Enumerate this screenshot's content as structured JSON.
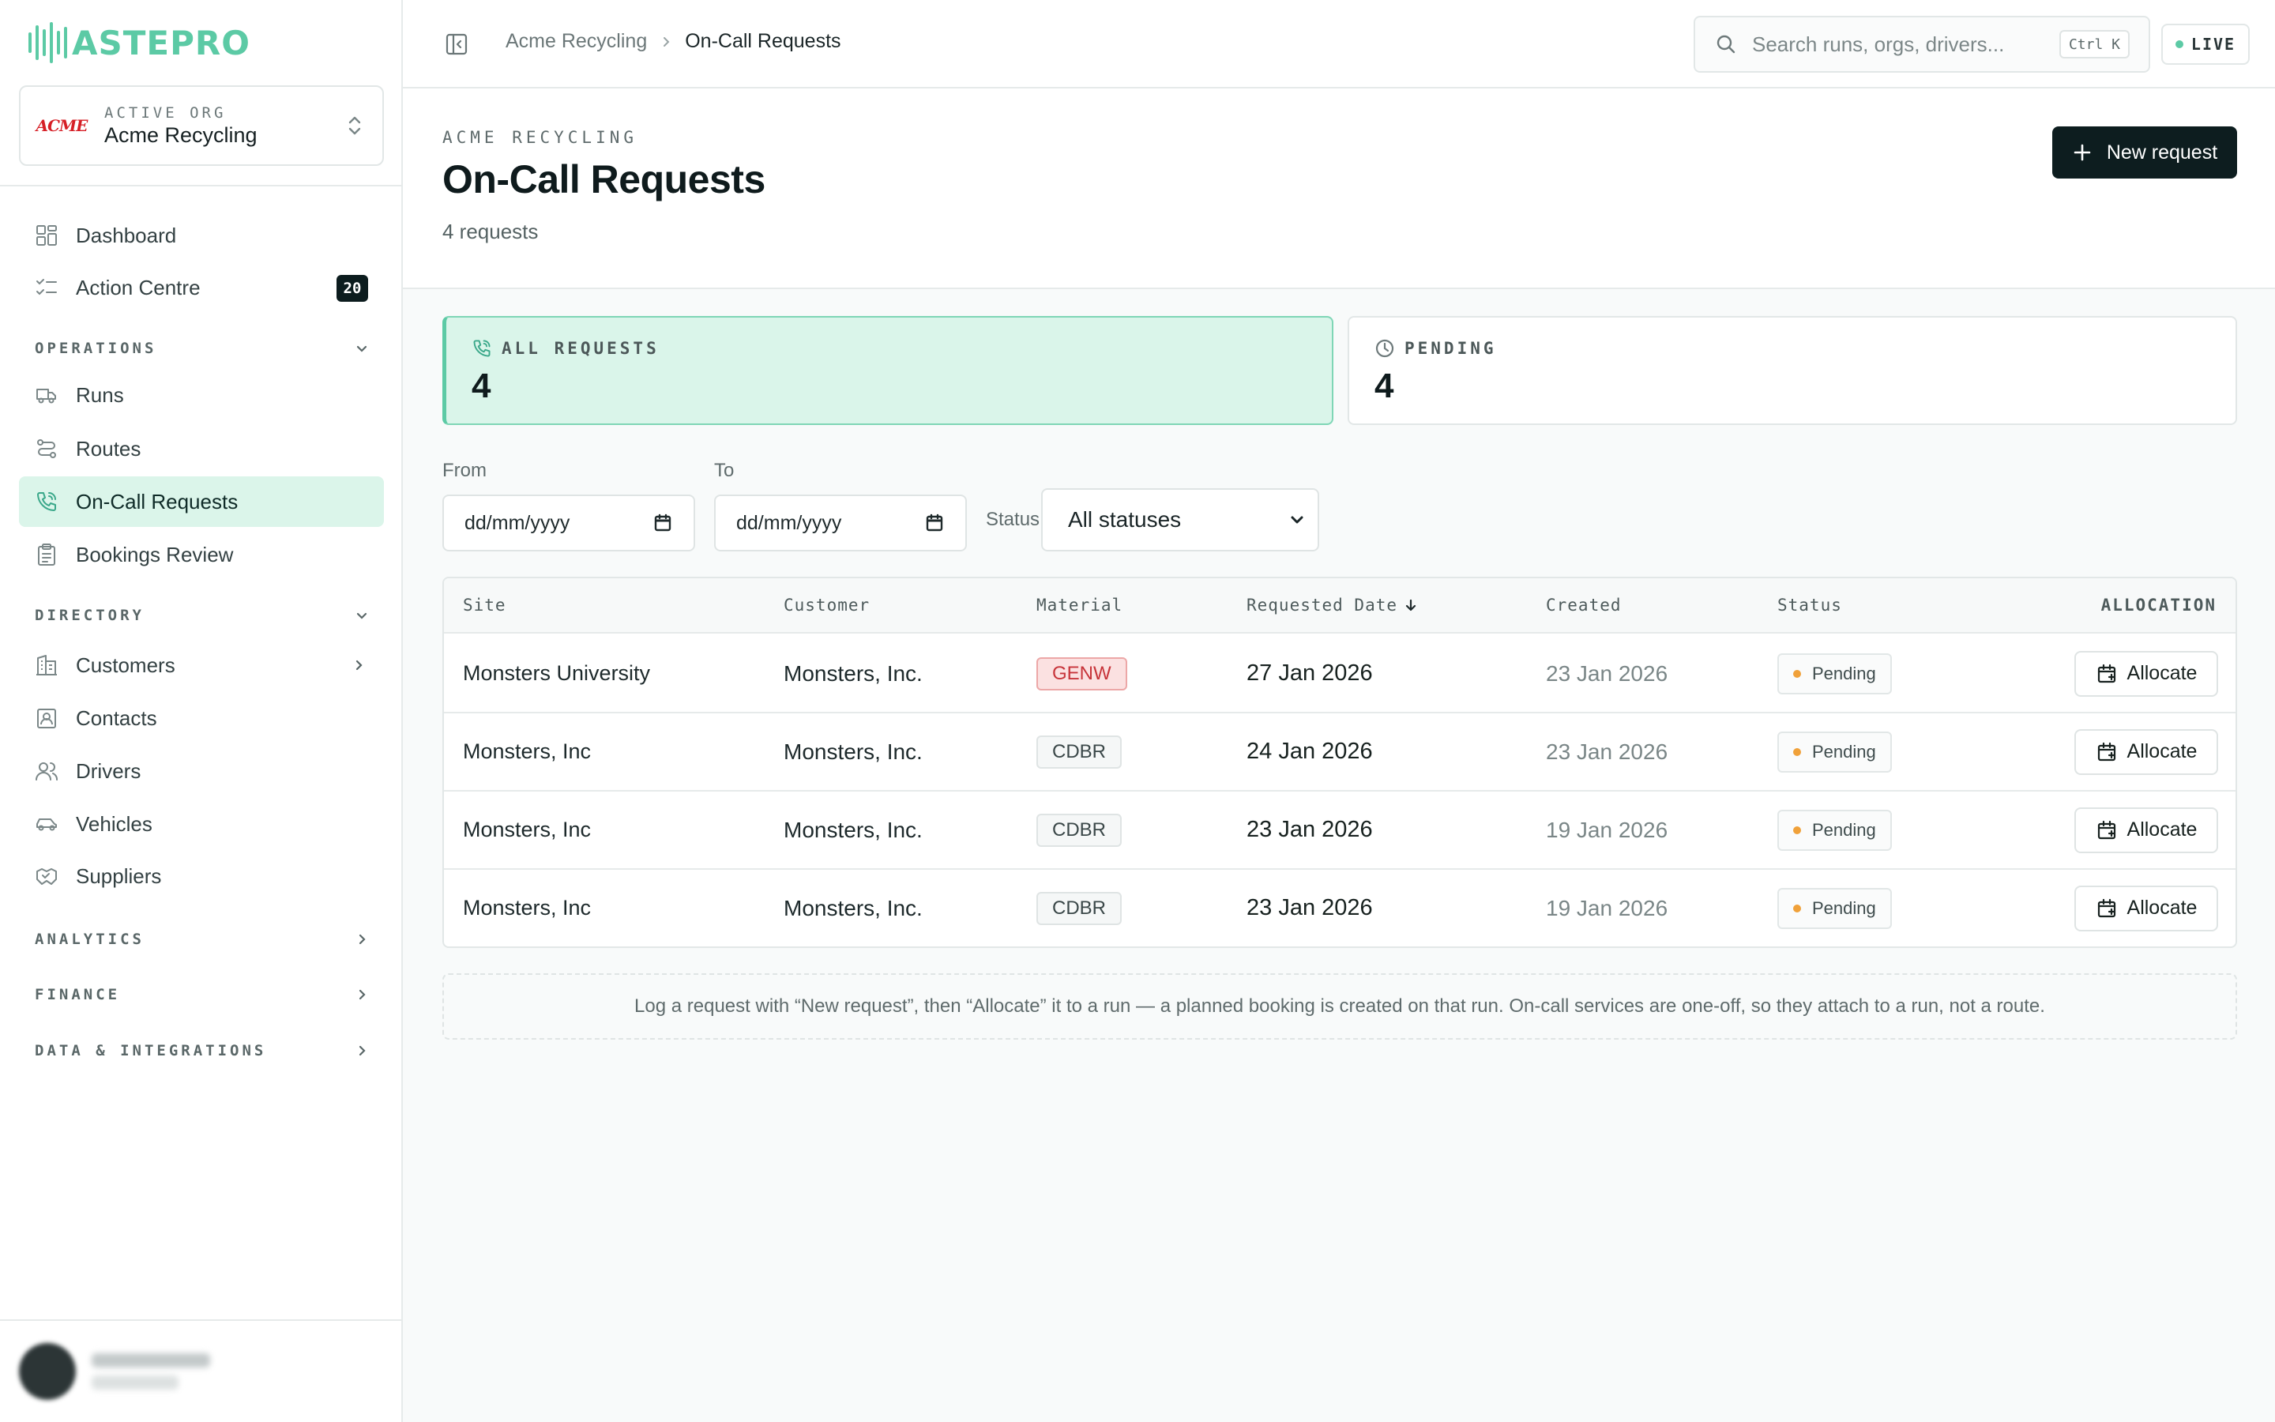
{
  "brand": {
    "logo_text": "ASTEPRO"
  },
  "org": {
    "label": "ACTIVE ORG",
    "name": "Acme Recycling",
    "logo_text": "ACME"
  },
  "nav": {
    "dashboard": "Dashboard",
    "action_centre": "Action Centre",
    "action_centre_badge": "20",
    "operations": {
      "title": "OPERATIONS",
      "items": [
        "Runs",
        "Routes",
        "On-Call Requests",
        "Bookings Review"
      ]
    },
    "directory": {
      "title": "DIRECTORY",
      "items": [
        "Customers",
        "Contacts",
        "Drivers",
        "Vehicles",
        "Suppliers"
      ]
    },
    "analytics": "ANALYTICS",
    "finance": "FINANCE",
    "data_integrations": "DATA & INTEGRATIONS"
  },
  "breadcrumb": {
    "parent": "Acme Recycling",
    "current": "On-Call Requests"
  },
  "search": {
    "placeholder": "Search runs, orgs, drivers...",
    "shortcut": "Ctrl K"
  },
  "live_label": "LIVE",
  "header": {
    "eyebrow": "ACME RECYCLING",
    "title": "On-Call Requests",
    "subtitle": "4 requests",
    "new_button": "New request"
  },
  "stats": [
    {
      "label": "ALL REQUESTS",
      "value": "4",
      "icon": "phone-icon"
    },
    {
      "label": "PENDING",
      "value": "4",
      "icon": "clock-icon"
    }
  ],
  "filters": {
    "from_label": "From",
    "to_label": "To",
    "date_placeholder": "dd/mm/yyyy",
    "status_label": "Status",
    "status_value": "All statuses"
  },
  "table": {
    "columns": {
      "site": "Site",
      "customer": "Customer",
      "material": "Material",
      "requested_date": "Requested Date",
      "created": "Created",
      "status": "Status",
      "allocation": "ALLOCATION"
    },
    "action_label": "Allocate",
    "rows": [
      {
        "site": "Monsters University",
        "customer": "Monsters, Inc.",
        "material": "GENW",
        "requested_date": "27 Jan 2026",
        "created": "23 Jan 2026",
        "status": "Pending"
      },
      {
        "site": "Monsters, Inc",
        "customer": "Monsters, Inc.",
        "material": "CDBR",
        "requested_date": "24 Jan 2026",
        "created": "23 Jan 2026",
        "status": "Pending"
      },
      {
        "site": "Monsters, Inc",
        "customer": "Monsters, Inc.",
        "material": "CDBR",
        "requested_date": "23 Jan 2026",
        "created": "19 Jan 2026",
        "status": "Pending"
      },
      {
        "site": "Monsters, Inc",
        "customer": "Monsters, Inc.",
        "material": "CDBR",
        "requested_date": "23 Jan 2026",
        "created": "19 Jan 2026",
        "status": "Pending"
      }
    ]
  },
  "hint": "Log a request with “New request”, then “Allocate” it to a run — a planned booking is created on that run. On-call services are one-off, so they attach to a run, not a route.",
  "colors": {
    "accent": "#5ccaa5",
    "active_bg": "#dbf5ea",
    "dark": "#0d1d1f",
    "pending": "#f0a13a",
    "hazard": "#c7343a"
  }
}
